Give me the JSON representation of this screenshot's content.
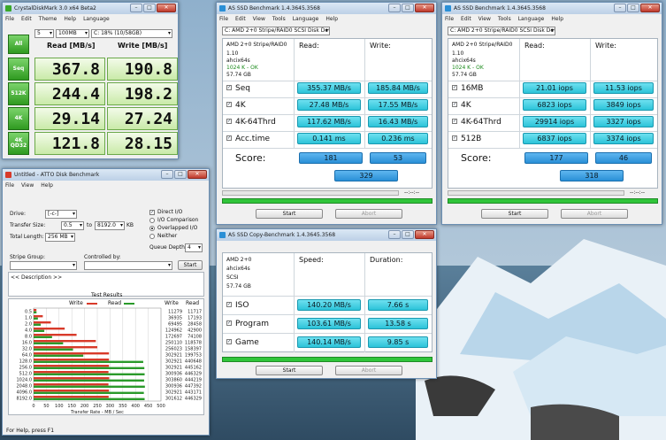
{
  "crystal": {
    "title": "CrystalDiskMark 3.0 x64 Beta2",
    "menu": [
      "File",
      "Edit",
      "Theme",
      "Help",
      "Language"
    ],
    "all_label": "All",
    "runs": "5",
    "size": "100MB",
    "drive": "C: 18% (10/58GB)",
    "read_header": "Read [MB/s]",
    "write_header": "Write [MB/s]",
    "rows": [
      {
        "label": "Seq",
        "read": "367.8",
        "write": "190.8"
      },
      {
        "label": "512K",
        "read": "244.4",
        "write": "198.2"
      },
      {
        "label": "4K",
        "read": "29.14",
        "write": "27.24"
      },
      {
        "label": "4K QD32",
        "read": "121.8",
        "write": "28.15"
      }
    ]
  },
  "ssd1": {
    "title": "AS SSD Benchmark 1.4.3645.3568",
    "menu": [
      "File",
      "Edit",
      "View",
      "Tools",
      "Language",
      "Help"
    ],
    "device": "C: AMD 2+0 Stripe/RAID0 SCSI Disk Device",
    "info": [
      "AMD 2+0 Stripe/RAID0",
      "1.10",
      "ahcix64s",
      "1024 K - OK",
      "57.74 GB"
    ],
    "read_header": "Read:",
    "write_header": "Write:",
    "rows": [
      {
        "label": "Seq",
        "read": "355.37 MB/s",
        "write": "185.84 MB/s"
      },
      {
        "label": "4K",
        "read": "27.48 MB/s",
        "write": "17.55 MB/s"
      },
      {
        "label": "4K-64Thrd",
        "read": "117.62 MB/s",
        "write": "16.43 MB/s"
      },
      {
        "label": "Acc.time",
        "read": "0.141 ms",
        "write": "0.236 ms"
      }
    ],
    "score_label": "Score:",
    "score_read": "181",
    "score_write": "53",
    "score_total": "329",
    "progress_text": "--:--:--",
    "start": "Start",
    "abort": "Abort"
  },
  "ssd2": {
    "title": "AS SSD Benchmark 1.4.3645.3568",
    "menu": [
      "File",
      "Edit",
      "View",
      "Tools",
      "Language",
      "Help"
    ],
    "device": "C: AMD 2+0 Stripe/RAID0 SCSI Disk Device",
    "info": [
      "AMD 2+0 Stripe/RAID0",
      "1.10",
      "ahcix64s",
      "1024 K - OK",
      "57.74 GB"
    ],
    "read_header": "Read:",
    "write_header": "Write:",
    "rows": [
      {
        "label": "16MB",
        "read": "21.01 iops",
        "write": "11.53 iops"
      },
      {
        "label": "4K",
        "read": "6823 iops",
        "write": "3849 iops"
      },
      {
        "label": "4K-64Thrd",
        "read": "29914 iops",
        "write": "3327 iops"
      },
      {
        "label": "512B",
        "read": "6837 iops",
        "write": "3374 iops"
      }
    ],
    "score_label": "Score:",
    "score_read": "177",
    "score_write": "46",
    "score_total": "318",
    "progress_text": "--:--:--",
    "start": "Start",
    "abort": "Abort"
  },
  "copy": {
    "title": "AS SSD Copy-Benchmark 1.4.3645.3568",
    "info": [
      "AMD 2+0",
      "ahcix64s",
      "SCSI",
      "57.74 GB"
    ],
    "speed_header": "Speed:",
    "duration_header": "Duration:",
    "rows": [
      {
        "label": "ISO",
        "speed": "140.20 MB/s",
        "duration": "7.66 s"
      },
      {
        "label": "Program",
        "speed": "103.61 MB/s",
        "duration": "13.58 s"
      },
      {
        "label": "Game",
        "speed": "140.14 MB/s",
        "duration": "9.85 s"
      }
    ],
    "start": "Start",
    "abort": "Abort"
  },
  "atto": {
    "title": "Untitled - ATTO Disk Benchmark",
    "menu": [
      "File",
      "View",
      "Help"
    ],
    "drive_label": "Drive:",
    "drive": "[-c-]",
    "transfer_label": "Transfer Size:",
    "transfer_from": "0.5",
    "to_label": "to",
    "transfer_to": "8192.0",
    "kb_label": "KB",
    "total_label": "Total Length:",
    "total": "256 MB",
    "direct_io": "Direct I/O",
    "io_comparison": "I/O Comparison",
    "overlapped": "Overlapped I/O",
    "neither": "Neither",
    "queue_label": "Queue Depth:",
    "queue": "4",
    "stripe_label": "Stripe Group:",
    "controlled_label": "Controlled by:",
    "start": "Start",
    "description": "<< Description >>",
    "results_title": "Test Results",
    "write_legend": "Write",
    "read_legend": "Read",
    "write_col": "Write",
    "read_col": "Read",
    "x_ticks": [
      "0",
      "50",
      "100",
      "150",
      "200",
      "250",
      "300",
      "350",
      "400",
      "450",
      "500"
    ],
    "x_label": "Transfer Rate - MB / Sec",
    "status": "For Help, press F1",
    "chart_data": {
      "type": "bar",
      "categories": [
        "0.5",
        "1.0",
        "2.0",
        "4.0",
        "8.0",
        "16.0",
        "32.0",
        "64.0",
        "128.0",
        "256.0",
        "512.0",
        "1024.0",
        "2048.0",
        "4096.0",
        "8192.0"
      ],
      "series": [
        {
          "name": "Write",
          "values": [
            11279,
            36935,
            69495,
            124962,
            172697,
            250110,
            256023,
            302921,
            302921,
            302921,
            300936,
            303860,
            300936,
            302921,
            301612
          ]
        },
        {
          "name": "Read",
          "values": [
            11717,
            17193,
            28458,
            42900,
            74108,
            118578,
            158397,
            199753,
            440648,
            445162,
            446329,
            444219,
            447392,
            443171,
            446329
          ]
        }
      ],
      "xlim": [
        0,
        500
      ]
    }
  },
  "colors": {
    "cdm_green": "#3aa82a",
    "ssd_cyan": "#2cc3d8",
    "atto_write": "#d83a2a",
    "atto_read": "#2a9a2a"
  }
}
